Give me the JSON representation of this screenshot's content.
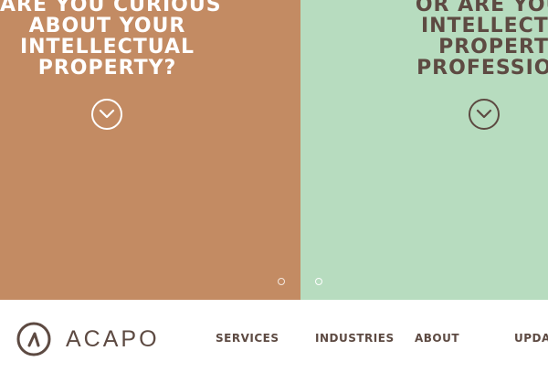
{
  "hero": {
    "left": {
      "lines": [
        "ARE YOU CURIOUS",
        "ABOUT YOUR",
        "INTELLECTUAL",
        "PROPERTY?"
      ],
      "button_icon": "chevron-down-icon",
      "bg_color": "#c38b63",
      "text_color": "#ffffff"
    },
    "right": {
      "lines": [
        "OR ARE YOU A",
        "INTELLECTUA",
        "PROPERTY",
        "PROFESSIONA"
      ],
      "button_icon": "chevron-down-icon",
      "bg_color": "#b7dcbf",
      "text_color": "#5d4a42"
    },
    "slides": {
      "count": 2
    }
  },
  "header": {
    "logo_text": "ACAPO",
    "logo_icon": "acapo-logo-icon",
    "nav": [
      "SERVICES",
      "INDUSTRIES",
      "ABOUT",
      "UPDA"
    ]
  }
}
